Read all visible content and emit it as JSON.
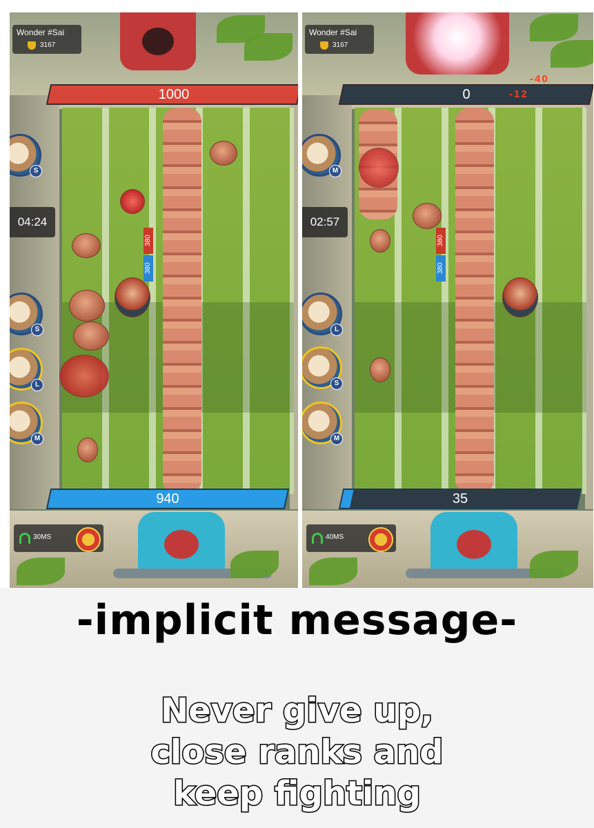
{
  "left_panel": {
    "player_name": "Wonder #Sai",
    "trophies": "3167",
    "enemy_hp": "1000",
    "player_hp": "940",
    "timer": "04:24",
    "level_red": "380",
    "level_blue": "380",
    "ping": "30MS",
    "avatars": [
      "S",
      "S",
      "L",
      "M"
    ]
  },
  "right_panel": {
    "player_name": "Wonder #Sai",
    "trophies": "3167",
    "enemy_hp": "0",
    "damage_1": "-40",
    "damage_2": "-12",
    "player_hp": "35",
    "timer": "02:57",
    "level_red": "380",
    "level_blue": "380",
    "ping": "40MS",
    "avatars": [
      "M",
      "L",
      "S",
      "M"
    ]
  },
  "caption": {
    "title": "-implicit message-",
    "lines": [
      "Never give up,",
      "close ranks and",
      "keep fighting"
    ]
  }
}
